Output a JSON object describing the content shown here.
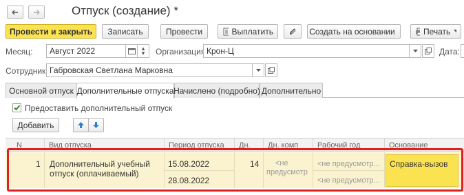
{
  "title": "Отпуск (создание) *",
  "toolbar": {
    "post_close": "Провести и закрыть",
    "save": "Записать",
    "post": "Провести",
    "pay": "Выплатить",
    "create_based": "Создать на основании",
    "print": "Печать"
  },
  "form": {
    "month_label": "Месяц:",
    "month_value": "Август 2022",
    "org_label": "Организация:",
    "org_value": "Крон-Ц",
    "date_label": "Дата:",
    "employee_label": "Сотрудник:",
    "employee_value": "Габровская Светлана Марковна"
  },
  "tabs": [
    "Основной отпуск",
    "Дополнительные отпуска",
    "Начислено (подробно)",
    "Дополнительно"
  ],
  "active_tab": 1,
  "checkbox": {
    "label": "Предоставить дополнительный отпуск",
    "checked": true
  },
  "add_button": "Добавить",
  "table": {
    "columns": [
      "N",
      "Вид отпуска",
      "Период отпуска",
      "Дн.",
      "Дн. комп",
      "Рабочий год",
      "Основание"
    ],
    "rows": [
      {
        "n": "1",
        "kind_line1": "Дополнительный учебный",
        "kind_line2": "отпуск (оплачиваемый)",
        "period_start": "15.08.2022",
        "period_end": "28.08.2022",
        "days": "14",
        "comp_line1": "<не",
        "comp_line2": "предусмотр",
        "work_year_1": "<не предусмотр...",
        "work_year_2": "<не предусмотр...",
        "basis": "Справка-вызов"
      }
    ]
  },
  "highlight_color": "#e0201b",
  "primary_color": "#fbe251"
}
